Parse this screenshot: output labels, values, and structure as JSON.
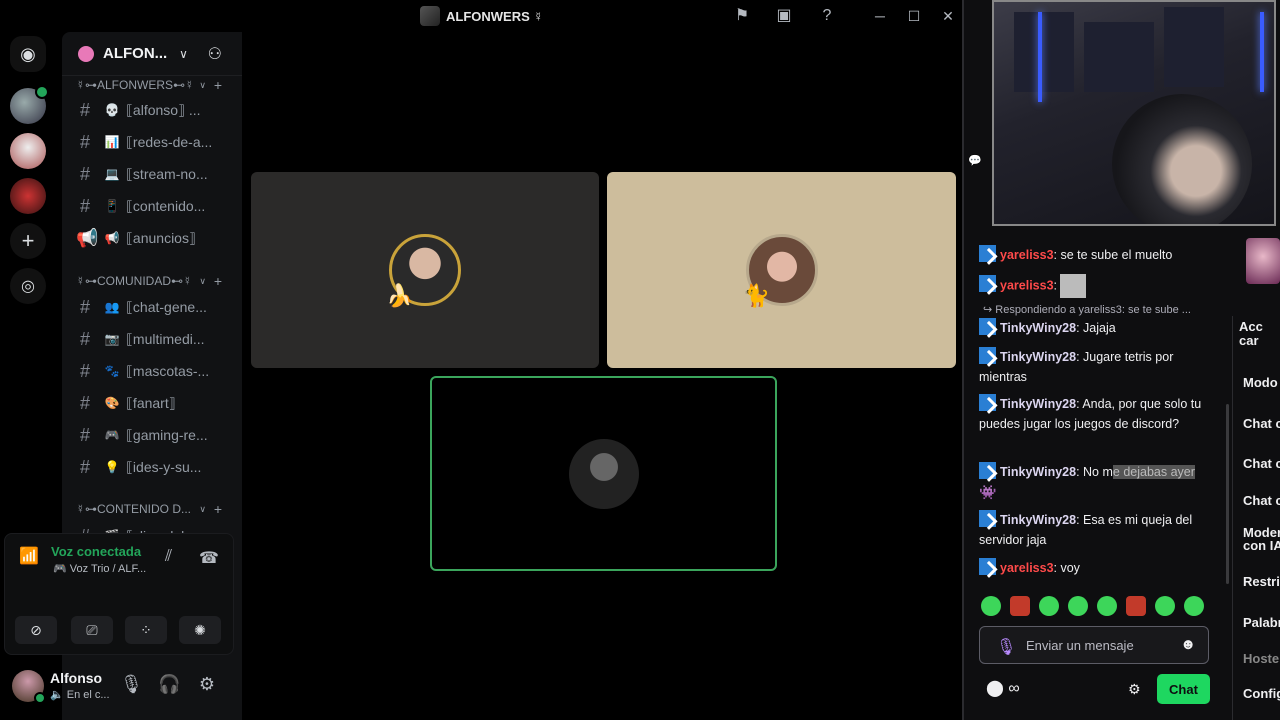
{
  "discord": {
    "window_title": "ALFONWERS ☿",
    "server_name": "ALFON...",
    "categories": [
      {
        "label": "☿⊶ALFONWERS⊷☿"
      },
      {
        "label": "☿⊶COMUNIDAD⊷☿"
      },
      {
        "label": "☿⊶CONTENIDO D..."
      }
    ],
    "channels": [
      {
        "emoji": "💀",
        "name": "⟦alfonso⟧ ..."
      },
      {
        "emoji": "📊",
        "name": "⟦redes-de-a..."
      },
      {
        "emoji": "💻",
        "name": "⟦stream-no..."
      },
      {
        "emoji": "📱",
        "name": "⟦contenido..."
      },
      {
        "emoji": "📢",
        "name": "⟦anuncios⟧"
      },
      {
        "emoji": "👥",
        "name": "⟦chat-gene..."
      },
      {
        "emoji": "📷",
        "name": "⟦multimedi..."
      },
      {
        "emoji": "🐾",
        "name": "⟦mascotas-..."
      },
      {
        "emoji": "🎨",
        "name": "⟦fanart⟧"
      },
      {
        "emoji": "🎮",
        "name": "⟦gaming-re..."
      },
      {
        "emoji": "💡",
        "name": "⟦ides-y-su..."
      },
      {
        "emoji": "🎬",
        "name": "⟦clips-del-s..."
      }
    ],
    "voice": {
      "status": "Voz conectada",
      "channel": "🎮 Voz Trio / ALF..."
    },
    "user": {
      "name": "Alfonso",
      "status": "🔈 En el c..."
    }
  },
  "twitch": {
    "messages": [
      {
        "user": "yareliss3",
        "text": "se te sube el muelto"
      },
      {
        "user": "yareliss3",
        "text": ""
      },
      {
        "reply": "Respondiendo a yareliss3: se te sube ..."
      },
      {
        "user": "TinkyWiny28",
        "text": "Jajaja"
      },
      {
        "user": "TinkyWiny28",
        "text": "Jugare tetris por mientras"
      },
      {
        "user": "TinkyWiny28",
        "text": "Anda, por que solo tu puedes jugar los juegos de discord?"
      },
      {
        "user": "TinkyWiny28",
        "text_plain": "No m",
        "text_hl": "e dejabas ayer"
      },
      {
        "user": "TinkyWiny28",
        "text": "Esa es mi queja del servidor jaja"
      },
      {
        "user": "yareliss3",
        "text": "voy"
      }
    ],
    "input_placeholder": "Enviar un mensaje",
    "chat_button": "Chat",
    "mod_title": "Acc car",
    "mod_items": [
      "Modo",
      "Chat c",
      "Chat c",
      "Chat c",
      "Moder con IA",
      "Restri",
      "Palabr",
      "Hoste",
      "Config"
    ]
  }
}
